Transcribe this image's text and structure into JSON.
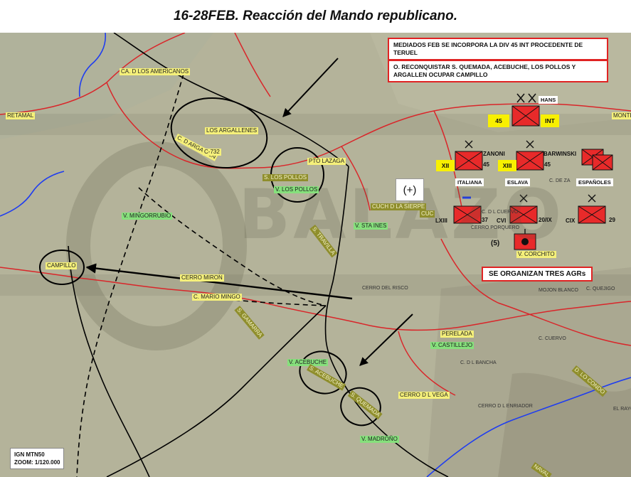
{
  "title": "16-28FEB. Reacción del Mando republicano.",
  "boxes": {
    "div45": "MEDIADOS FEB SE INCORPORA LA DIV 45 INT PROCEDENTE DE TERUEL",
    "objective": "O. RECONQUISTAR S. QUEMADA, ACEBUCHE, LOS POLLOS Y ARGALLEN OCUPAR CAMPILLO",
    "agrs": "SE ORGANIZAN TRES AGRs"
  },
  "places": {
    "americanos": "CA. D LOS AMERICANOS",
    "retamal": "RETAMAL",
    "argallenes": "LOS ARGALLENES",
    "dargallen": "C. D ARGALLEN",
    "c732": "C-732",
    "ptolazaga": "PTO LAZAGA",
    "spollos": "S. LOS POLLOS",
    "vpollos": "V. LOS POLLOS",
    "mingorrubio": "V. MINGORRUBIO",
    "cuchsierpe": "CUCH D LA SIERPE",
    "cuc": "CUC",
    "vstaines": "V. STA INES",
    "stravilla": "S. TRAVILLA",
    "campillo": "CAMPILLO",
    "cerromiron": "CERRO MIRON",
    "cmariomingo": "C. MARIO MINGO",
    "gamarra": "S. GAMARRA",
    "cerrorisco": "CERRO DEL RISCO",
    "perelada": "PERELADA",
    "vcastillejo": "V. CASTILLEJO",
    "vacebuche": "V. ACEBUCHE",
    "sacebuche": "S. ACEBUCHE",
    "squemada": "S. QUEMADA",
    "cerrovega": "CERRO D L VEGA",
    "vmadrono": "V. MADROÑO",
    "vcorchito": "V. CORCHITO",
    "monte": "MONTE",
    "cdlbancha": "C. D L BANCHA",
    "cdlenriador": "CERRO D L ENRIADOR",
    "dlcondo": "D. LO CONDO",
    "rayo": "EL RAYO",
    "mojon": "MOJON BLANCO",
    "cquejigo": "C. QUEJIGO",
    "cporquero": "CERRO PORQUERO",
    "cenizas": "C. DE ZA",
    "naval": "NAVAL",
    "cdlcuervo": "C. D L CUERVO",
    "cuervo2": "C. CUERVO"
  },
  "units": {
    "hans": "HANS",
    "div": "45",
    "int": "INT",
    "zanoni": "ZANONI",
    "barwinski": "BARWINSKI",
    "xii": "XII",
    "xiii": "XIII",
    "n45a": "45",
    "n45b": "45",
    "italiana": "ITALIANA",
    "eslava": "ESLAVA",
    "espanoles": "ESPAÑOLES",
    "lxiii": "LXIII",
    "n37": "37",
    "cvi": "CVI",
    "n20ix": "20/IX",
    "cix": "CIX",
    "n29": "29",
    "plus": "(+)",
    "five": "(5)"
  },
  "watermark": "BALAZO",
  "ign": {
    "line1": "IGN MTN50",
    "line2": "ZOOM: 1/120.000"
  },
  "colors": {
    "unit_fill": "#e82a2a",
    "frame_red": "#e02323",
    "road": "#d9262a",
    "river": "#1f3df0",
    "front": "#000000"
  }
}
